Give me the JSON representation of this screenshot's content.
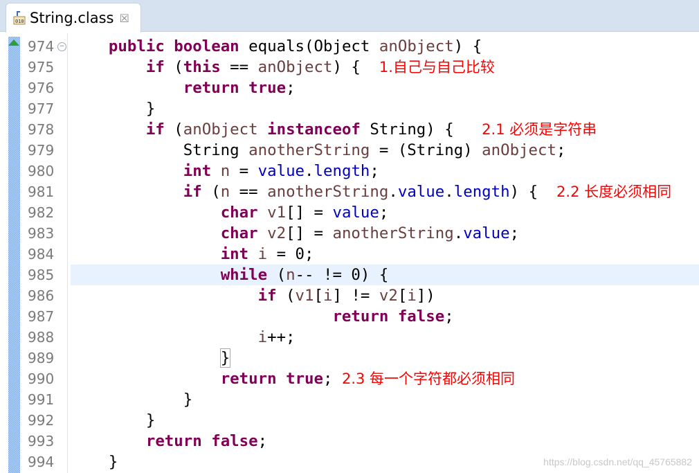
{
  "tab": {
    "title": "String.class",
    "close": "☒",
    "icon": "class-file-icon"
  },
  "colors": {
    "keyword": "#7f0055",
    "field": "#0000c0",
    "variable": "#6a3e3e",
    "annotation": "#ff0000",
    "current_line": "#e8f2fe"
  },
  "highlighted_line": "985",
  "lines": [
    {
      "n": "974",
      "fold": true,
      "t": [
        [
          "",
          "    "
        ],
        [
          "kw",
          "public"
        ],
        [
          "",
          " "
        ],
        [
          "kw",
          "boolean"
        ],
        [
          "",
          " equals(Object "
        ],
        [
          "var",
          "anObject"
        ],
        [
          "",
          ") {"
        ]
      ]
    },
    {
      "n": "975",
      "t": [
        [
          "",
          "        "
        ],
        [
          "kw",
          "if"
        ],
        [
          "",
          " ("
        ],
        [
          "kw",
          "this"
        ],
        [
          "",
          " == "
        ],
        [
          "var",
          "anObject"
        ],
        [
          "",
          ") {  "
        ],
        [
          "note",
          "1.自己与自己比较"
        ]
      ]
    },
    {
      "n": "976",
      "t": [
        [
          "",
          "            "
        ],
        [
          "kw",
          "return"
        ],
        [
          "",
          " "
        ],
        [
          "kw",
          "true"
        ],
        [
          "",
          ";"
        ]
      ]
    },
    {
      "n": "977",
      "t": [
        [
          "",
          "        }"
        ]
      ]
    },
    {
      "n": "978",
      "t": [
        [
          "",
          "        "
        ],
        [
          "kw",
          "if"
        ],
        [
          "",
          " ("
        ],
        [
          "var",
          "anObject"
        ],
        [
          "",
          " "
        ],
        [
          "kw",
          "instanceof"
        ],
        [
          "",
          " String) {   "
        ],
        [
          "note",
          "2.1 必须是字符串"
        ]
      ]
    },
    {
      "n": "979",
      "t": [
        [
          "",
          "            String "
        ],
        [
          "var",
          "anotherString"
        ],
        [
          "",
          " = (String) "
        ],
        [
          "var",
          "anObject"
        ],
        [
          "",
          ";"
        ]
      ]
    },
    {
      "n": "980",
      "t": [
        [
          "",
          "            "
        ],
        [
          "kw",
          "int"
        ],
        [
          "",
          " "
        ],
        [
          "var",
          "n"
        ],
        [
          "",
          " = "
        ],
        [
          "fld",
          "value"
        ],
        [
          "",
          "."
        ],
        [
          "fld",
          "length"
        ],
        [
          "",
          ";"
        ]
      ]
    },
    {
      "n": "981",
      "t": [
        [
          "",
          "            "
        ],
        [
          "kw",
          "if"
        ],
        [
          "",
          " ("
        ],
        [
          "var",
          "n"
        ],
        [
          "",
          " == "
        ],
        [
          "var",
          "anotherString"
        ],
        [
          "",
          "."
        ],
        [
          "fld",
          "value"
        ],
        [
          "",
          "."
        ],
        [
          "fld",
          "length"
        ],
        [
          "",
          ") {  "
        ],
        [
          "note",
          "2.2 长度必须相同"
        ]
      ]
    },
    {
      "n": "982",
      "t": [
        [
          "",
          "                "
        ],
        [
          "kw",
          "char"
        ],
        [
          "",
          " "
        ],
        [
          "var",
          "v1"
        ],
        [
          "",
          "[] = "
        ],
        [
          "fld",
          "value"
        ],
        [
          "",
          ";"
        ]
      ]
    },
    {
      "n": "983",
      "t": [
        [
          "",
          "                "
        ],
        [
          "kw",
          "char"
        ],
        [
          "",
          " "
        ],
        [
          "var",
          "v2"
        ],
        [
          "",
          "[] = "
        ],
        [
          "var",
          "anotherString"
        ],
        [
          "",
          "."
        ],
        [
          "fld",
          "value"
        ],
        [
          "",
          ";"
        ]
      ]
    },
    {
      "n": "984",
      "t": [
        [
          "",
          "                "
        ],
        [
          "kw",
          "int"
        ],
        [
          "",
          " "
        ],
        [
          "var",
          "i"
        ],
        [
          "",
          " = 0;"
        ]
      ]
    },
    {
      "n": "985",
      "t": [
        [
          "",
          "                "
        ],
        [
          "kw",
          "while"
        ],
        [
          "",
          " ("
        ],
        [
          "var",
          "n"
        ],
        [
          "",
          "-- != 0) {"
        ]
      ]
    },
    {
      "n": "986",
      "t": [
        [
          "",
          "                    "
        ],
        [
          "kw",
          "if"
        ],
        [
          "",
          " ("
        ],
        [
          "var",
          "v1"
        ],
        [
          "",
          "["
        ],
        [
          "var",
          "i"
        ],
        [
          "",
          "] != "
        ],
        [
          "var",
          "v2"
        ],
        [
          "",
          "["
        ],
        [
          "var",
          "i"
        ],
        [
          "",
          "])"
        ]
      ]
    },
    {
      "n": "987",
      "t": [
        [
          "",
          "                            "
        ],
        [
          "kw",
          "return"
        ],
        [
          "",
          " "
        ],
        [
          "kw",
          "false"
        ],
        [
          "",
          ";"
        ]
      ]
    },
    {
      "n": "988",
      "t": [
        [
          "",
          "                    "
        ],
        [
          "var",
          "i"
        ],
        [
          "",
          "++;"
        ]
      ]
    },
    {
      "n": "989",
      "t": [
        [
          "",
          "                "
        ],
        [
          "box",
          "}"
        ]
      ]
    },
    {
      "n": "990",
      "t": [
        [
          "",
          "                "
        ],
        [
          "kw",
          "return"
        ],
        [
          "",
          " "
        ],
        [
          "kw",
          "true"
        ],
        [
          "",
          "; "
        ],
        [
          "note",
          "2.3 每一个字符都必须相同"
        ]
      ]
    },
    {
      "n": "991",
      "t": [
        [
          "",
          "            }"
        ]
      ]
    },
    {
      "n": "992",
      "t": [
        [
          "",
          "        }"
        ]
      ]
    },
    {
      "n": "993",
      "t": [
        [
          "",
          "        "
        ],
        [
          "kw",
          "return"
        ],
        [
          "",
          " "
        ],
        [
          "kw",
          "false"
        ],
        [
          "",
          ";"
        ]
      ]
    },
    {
      "n": "994",
      "t": [
        [
          "",
          "    }"
        ]
      ]
    }
  ],
  "watermark": "https://blog.csdn.net/qq_45765882"
}
